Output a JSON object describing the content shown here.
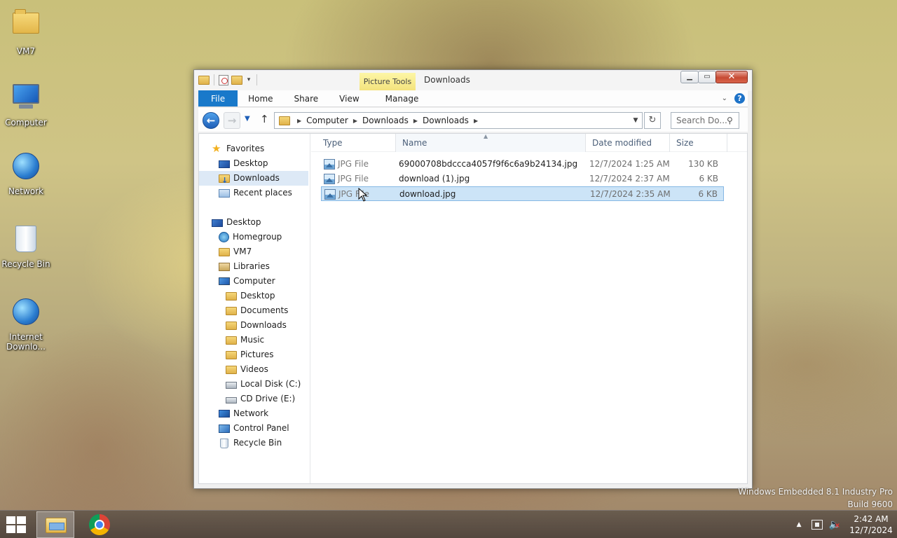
{
  "desktop": {
    "icons": [
      {
        "label": "VM7"
      },
      {
        "label": "Computer"
      },
      {
        "label": "Network"
      },
      {
        "label": "Recycle Bin"
      },
      {
        "label": "Internet Downlo..."
      }
    ]
  },
  "window": {
    "title": "Downloads",
    "contextual_tab_group": "Picture Tools",
    "ribbon_tabs": [
      "File",
      "Home",
      "Share",
      "View",
      "Manage"
    ],
    "help_label": "?",
    "address": {
      "crumbs": [
        "Computer",
        "Downloads",
        "Downloads"
      ]
    },
    "search": {
      "placeholder": "Search Do..."
    }
  },
  "nav_pane": {
    "items": [
      {
        "label": "Favorites",
        "icon": "star-icon"
      },
      {
        "label": "Desktop",
        "icon": "desktop-icon"
      },
      {
        "label": "Downloads",
        "icon": "downloads-folder-icon",
        "selected": true
      },
      {
        "label": "Recent places",
        "icon": "recent-places-icon"
      },
      {
        "label": "Desktop",
        "icon": "desktop-icon"
      },
      {
        "label": "Homegroup",
        "icon": "homegroup-icon"
      },
      {
        "label": "VM7",
        "icon": "user-folder-icon"
      },
      {
        "label": "Libraries",
        "icon": "libraries-icon"
      },
      {
        "label": "Computer",
        "icon": "computer-icon"
      },
      {
        "label": "Desktop",
        "icon": "folder-icon"
      },
      {
        "label": "Documents",
        "icon": "folder-icon"
      },
      {
        "label": "Downloads",
        "icon": "folder-icon"
      },
      {
        "label": "Music",
        "icon": "folder-icon"
      },
      {
        "label": "Pictures",
        "icon": "folder-icon"
      },
      {
        "label": "Videos",
        "icon": "folder-icon"
      },
      {
        "label": "Local Disk (C:)",
        "icon": "local-disk-icon"
      },
      {
        "label": "CD Drive (E:)",
        "icon": "cd-drive-icon"
      },
      {
        "label": "Network",
        "icon": "network-icon"
      },
      {
        "label": "Control Panel",
        "icon": "control-panel-icon"
      },
      {
        "label": "Recycle Bin",
        "icon": "recycle-bin-icon"
      }
    ]
  },
  "file_list": {
    "columns": [
      "Type",
      "Name",
      "Date modified",
      "Size"
    ],
    "sort_column": "Name",
    "rows": [
      {
        "type": "JPG File",
        "name": "69000708bdccca4057f9f6c6a9b24134.jpg",
        "date": "12/7/2024 1:25 AM",
        "size": "130 KB",
        "selected": false
      },
      {
        "type": "JPG File",
        "name": "download (1).jpg",
        "date": "12/7/2024 2:37 AM",
        "size": "6 KB",
        "selected": false
      },
      {
        "type": "JPG File",
        "name": "download.jpg",
        "date": "12/7/2024 2:35 AM",
        "size": "6 KB",
        "selected": true
      }
    ]
  },
  "watermark": {
    "line1": "Windows Embedded 8.1 Industry Pro",
    "line2": "Build 9600"
  },
  "taskbar": {
    "clock_time": "2:42 AM",
    "clock_date": "12/7/2024"
  },
  "colors": {
    "accent": "#1979ca",
    "selection": "#cce4f7",
    "close_button": "#c74a33"
  }
}
